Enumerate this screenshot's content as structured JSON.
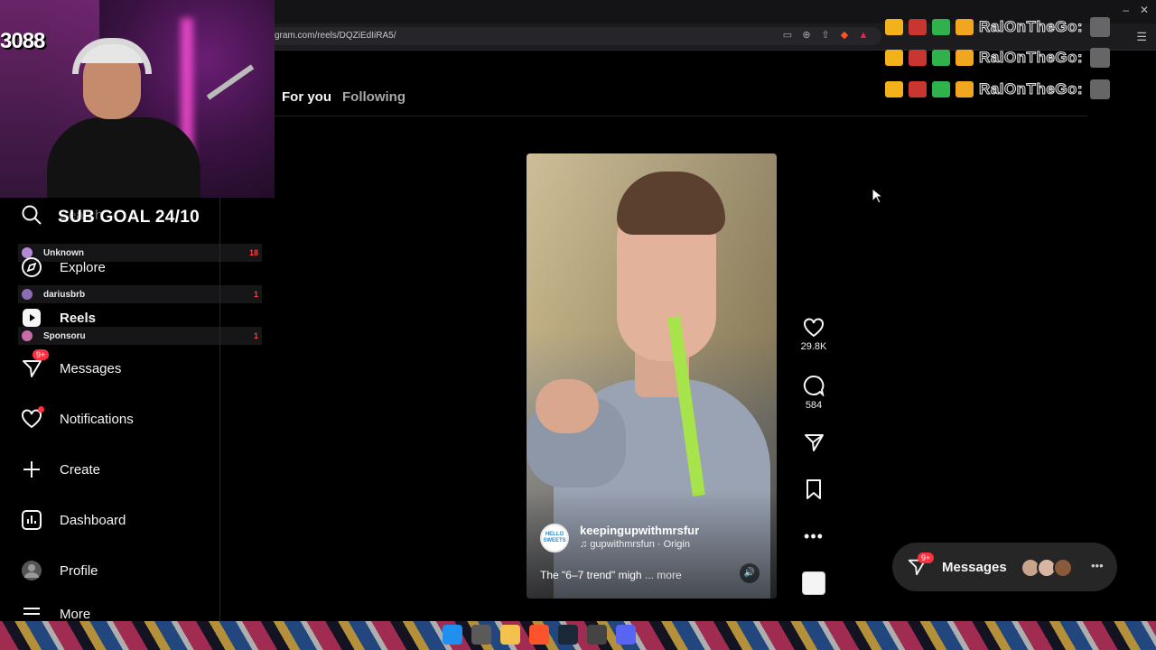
{
  "browser": {
    "url": "gram.com/reels/DQZiEdIiRA5/",
    "url_icons": [
      "screen-icon",
      "zoom-icon",
      "share-icon",
      "brave-icon",
      "triangle-icon"
    ]
  },
  "stream": {
    "viewer_number": "3088",
    "sub_goal": "SUB GOAL 24/10",
    "viewers": [
      {
        "name": "Unknown",
        "count": "18"
      },
      {
        "name": "dariusbrb",
        "count": "1"
      },
      {
        "name": "Sponsoru",
        "count": "1"
      }
    ],
    "chat": [
      {
        "name": "RalOnTheGo:"
      },
      {
        "name": "RalOnTheGo:"
      },
      {
        "name": "RalOnTheGo:"
      }
    ]
  },
  "sidebar": {
    "items": [
      {
        "label": "Search",
        "icon": "search-icon"
      },
      {
        "label": "Explore",
        "icon": "compass-icon"
      },
      {
        "label": "Reels",
        "icon": "reels-icon"
      },
      {
        "label": "Messages",
        "icon": "messages-icon",
        "badge": "9+"
      },
      {
        "label": "Notifications",
        "icon": "heart-icon"
      },
      {
        "label": "Create",
        "icon": "plus-icon"
      },
      {
        "label": "Dashboard",
        "icon": "dashboard-icon"
      },
      {
        "label": "Profile",
        "icon": "avatar-icon"
      },
      {
        "label": "More",
        "icon": "hamburger-icon"
      }
    ]
  },
  "feed": {
    "tabs": [
      {
        "label": "For you",
        "active": true
      },
      {
        "label": "Following",
        "active": false
      }
    ]
  },
  "reel": {
    "username": "keepingupwithmrsfur",
    "audio": "gupwithmrsfun · Origin",
    "caption": "The \"6–7 trend\" migh",
    "more_label": "... more",
    "avatar_text": "HELLO SWEETS",
    "likes": "29.8K",
    "comments": "584"
  },
  "messages_pill": {
    "label": "Messages",
    "badge": "9+"
  },
  "colors": {
    "accent_red": "#ff3040",
    "background": "#000000",
    "pill": "#262626"
  }
}
